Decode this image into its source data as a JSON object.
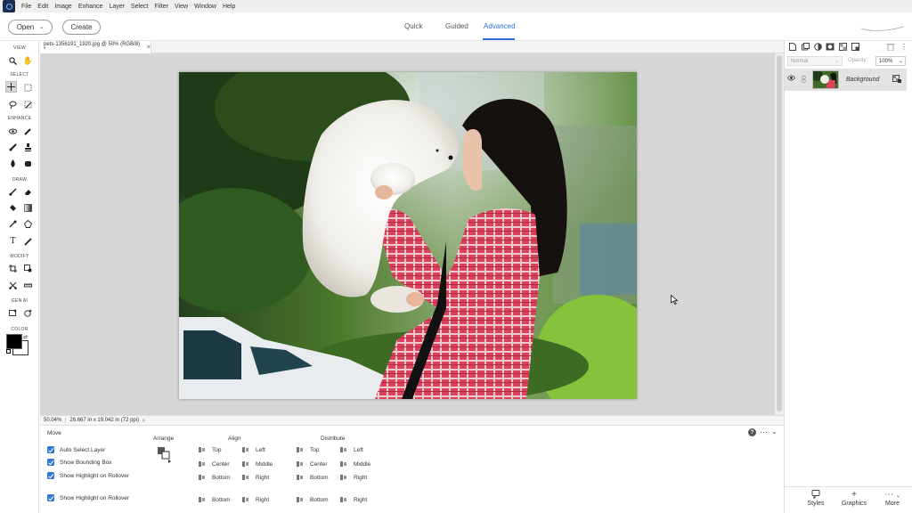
{
  "menubar": {
    "items": [
      "File",
      "Edit",
      "Image",
      "Enhance",
      "Layer",
      "Select",
      "Filter",
      "View",
      "Window",
      "Help"
    ]
  },
  "topbar": {
    "open_label": "Open",
    "create_label": "Create",
    "modes": [
      "Quick",
      "Guided",
      "Advanced"
    ],
    "active_mode": "Advanced"
  },
  "toolbar": {
    "sections": [
      "VIEW",
      "SELECT",
      "ENHANCE",
      "DRAW",
      "MODIFY",
      "GEN AI",
      "COLOR"
    ]
  },
  "document": {
    "tab_title": "pets-1356191_1920.jpg @ 50% (RGB/8) *",
    "close_glyph": "×",
    "zoom": "50.04%",
    "size": "26.667 in x 19.042 in (72 ppi)",
    "status_arrow": "›"
  },
  "options": {
    "move_title": "Move",
    "arrange_title": "Arrange",
    "align_title": "Align",
    "distribute_title": "Distribute",
    "checkboxes": [
      "Auto Select Layer",
      "Show Bounding Box",
      "Show Highlight on Rollover",
      "Show Highlight on Rollover"
    ],
    "align": {
      "col1": [
        "Top",
        "Center",
        "Bottom",
        "Bottom"
      ],
      "col2": [
        "Left",
        "Middle",
        "Right",
        "Right"
      ]
    },
    "distribute": {
      "col1": [
        "Top",
        "Center",
        "Bottom",
        "Bottom"
      ],
      "col2": [
        "Left",
        "Middle",
        "Right",
        "Right"
      ]
    }
  },
  "layers": {
    "blend_mode": "Normal",
    "opacity_label": "Opacity:",
    "opacity_value": "100%",
    "layer_name": "Background"
  },
  "right_bottom": {
    "items": [
      {
        "label": "Styles",
        "icon": "styles-icon"
      },
      {
        "label": "Graphics",
        "icon": "plus-icon"
      },
      {
        "label": "More",
        "icon": "more-icon"
      }
    ]
  },
  "colors": {
    "accent": "#2f6fd8",
    "canvas_bg": "#d6d6d6",
    "checkbox": "#2f7ad8"
  }
}
